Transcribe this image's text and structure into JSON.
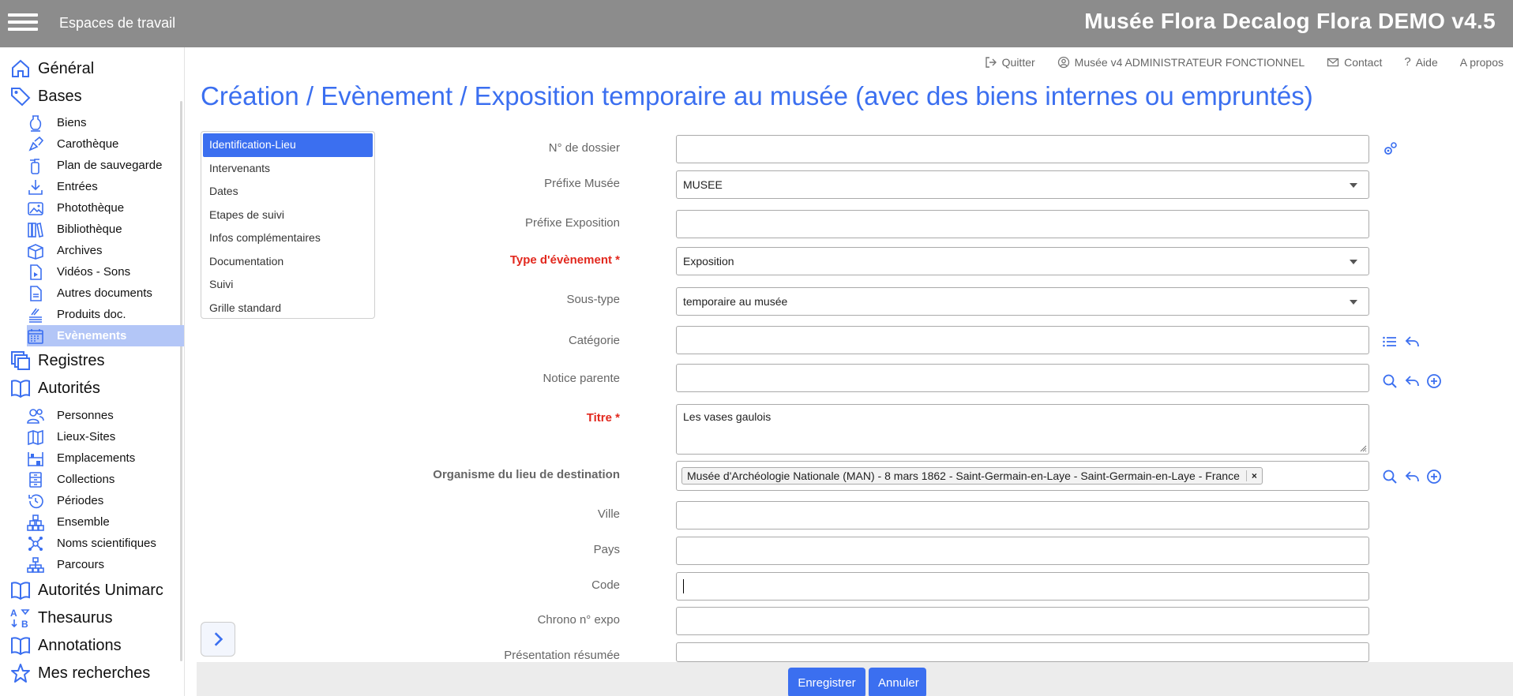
{
  "header": {
    "menu_icon": "hamburger-icon",
    "workspaces": "Espaces de travail",
    "title": "Musée Flora Decalog Flora DEMO v4.5"
  },
  "sidebar": {
    "sections": [
      {
        "label": "Général",
        "icon": "home-icon"
      },
      {
        "label": "Bases",
        "icon": "tag-icon"
      },
      {
        "label": "Registres",
        "icon": "registers-icon"
      },
      {
        "label": "Autorités",
        "icon": "book-icon"
      },
      {
        "label": "Autorités Unimarc",
        "icon": "book-icon"
      },
      {
        "label": "Thesaurus",
        "icon": "thesaurus-icon"
      },
      {
        "label": "Annotations",
        "icon": "book-icon"
      },
      {
        "label": "Mes recherches",
        "icon": "star-icon"
      }
    ],
    "bases_items": [
      {
        "label": "Biens"
      },
      {
        "label": "Carothèque"
      },
      {
        "label": "Plan de sauvegarde"
      },
      {
        "label": "Entrées"
      },
      {
        "label": "Photothèque"
      },
      {
        "label": "Bibliothèque"
      },
      {
        "label": "Archives"
      },
      {
        "label": "Vidéos - Sons"
      },
      {
        "label": "Autres documents"
      },
      {
        "label": "Produits doc."
      },
      {
        "label": "Evènements"
      }
    ],
    "autorites_items": [
      {
        "label": "Personnes"
      },
      {
        "label": "Lieux-Sites"
      },
      {
        "label": "Emplacements"
      },
      {
        "label": "Collections"
      },
      {
        "label": "Périodes"
      },
      {
        "label": "Ensemble"
      },
      {
        "label": "Noms scientifiques"
      },
      {
        "label": "Parcours"
      }
    ]
  },
  "toplinks": {
    "quit": "Quitter",
    "user": "Musée v4 ADMINISTRATEUR FONCTIONNEL",
    "contact": "Contact",
    "help": "Aide",
    "about": "A propos"
  },
  "page_title": "Création / Evènement / Exposition temporaire au musée (avec des biens internes ou empruntés)",
  "tabs": [
    "Identification-Lieu",
    "Intervenants",
    "Dates",
    "Etapes de suivi",
    "Infos complémentaires",
    "Documentation",
    "Suivi",
    "Grille standard"
  ],
  "form": {
    "dossier": {
      "label": "N° de dossier",
      "value": ""
    },
    "prefixe_musee": {
      "label": "Préfixe Musée",
      "value": "MUSEE"
    },
    "prefixe_expo": {
      "label": "Préfixe Exposition",
      "value": ""
    },
    "type_evenement": {
      "label": "Type d'évènement *",
      "value": "Exposition"
    },
    "sous_type": {
      "label": "Sous-type",
      "value": "temporaire au musée"
    },
    "categorie": {
      "label": "Catégorie",
      "value": ""
    },
    "notice_parente": {
      "label": "Notice parente",
      "value": ""
    },
    "titre": {
      "label": "Titre *",
      "value": "Les vases gaulois"
    },
    "organisme": {
      "label": "Organisme du lieu de destination",
      "value": "Musée d'Archéologie Nationale (MAN) - 8 mars 1862 - Saint-Germain-en-Laye - Saint-Germain-en-Laye - France",
      "remove": "×"
    },
    "ville": {
      "label": "Ville",
      "value": ""
    },
    "pays": {
      "label": "Pays",
      "value": ""
    },
    "code": {
      "label": "Code",
      "value": ""
    },
    "chrono": {
      "label": "Chrono n° expo",
      "value": ""
    },
    "presentation": {
      "label": "Présentation résumée",
      "value": ""
    }
  },
  "buttons": {
    "save": "Enregistrer",
    "cancel": "Annuler"
  },
  "colors": {
    "accent": "#3b6ff0",
    "header_bg": "#8c8c8c",
    "required": "#e2281e",
    "active_nav": "#b3c6f7"
  }
}
